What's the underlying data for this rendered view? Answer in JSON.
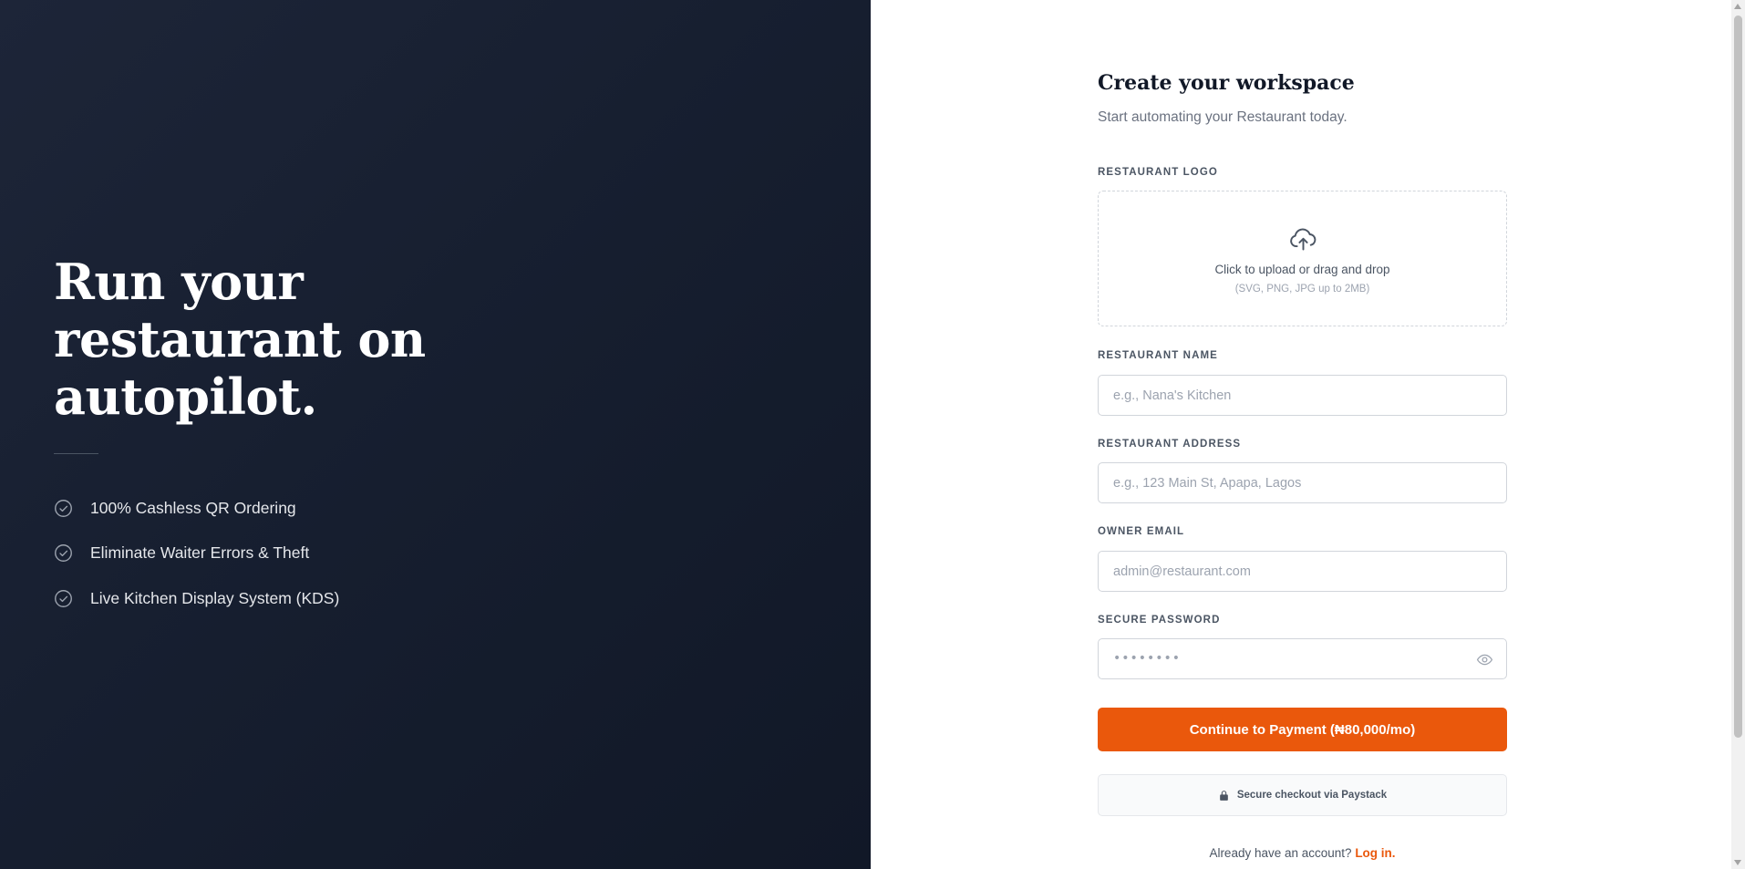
{
  "hero": {
    "title": "Run your restaurant on autopilot.",
    "features": [
      {
        "icon": "check-circle-icon",
        "text": "100% Cashless QR Ordering"
      },
      {
        "icon": "check-circle-icon",
        "text": "Eliminate Waiter Errors & Theft"
      },
      {
        "icon": "check-circle-icon",
        "text": "Live Kitchen Display System (KDS)"
      }
    ]
  },
  "form": {
    "title": "Create your workspace",
    "subtitle": "Start automating your Restaurant today.",
    "logo": {
      "label": "RESTAURANT LOGO",
      "icon": "cloud-upload-icon",
      "text": "Click to upload or drag and drop",
      "hint": "(SVG, PNG, JPG up to 2MB)"
    },
    "name": {
      "label": "RESTAURANT NAME",
      "placeholder": "e.g., Nana's Kitchen",
      "value": ""
    },
    "address": {
      "label": "RESTAURANT ADDRESS",
      "placeholder": "e.g., 123 Main St, Apapa, Lagos",
      "value": ""
    },
    "email": {
      "label": "OWNER EMAIL",
      "placeholder": "admin@restaurant.com",
      "value": ""
    },
    "password": {
      "label": "SECURE PASSWORD",
      "placeholder": "••••••••",
      "icon": "eye-icon"
    },
    "submit_label": "Continue to Payment (₦80,000/mo)",
    "secure": {
      "icon": "lock-icon",
      "text": "Secure checkout via Paystack"
    },
    "login": {
      "prompt": "Already have an account?",
      "link": "Log in."
    }
  },
  "colors": {
    "accent": "#ea580c",
    "panel_dark": "#161e2f",
    "muted_text": "#6b7280"
  }
}
